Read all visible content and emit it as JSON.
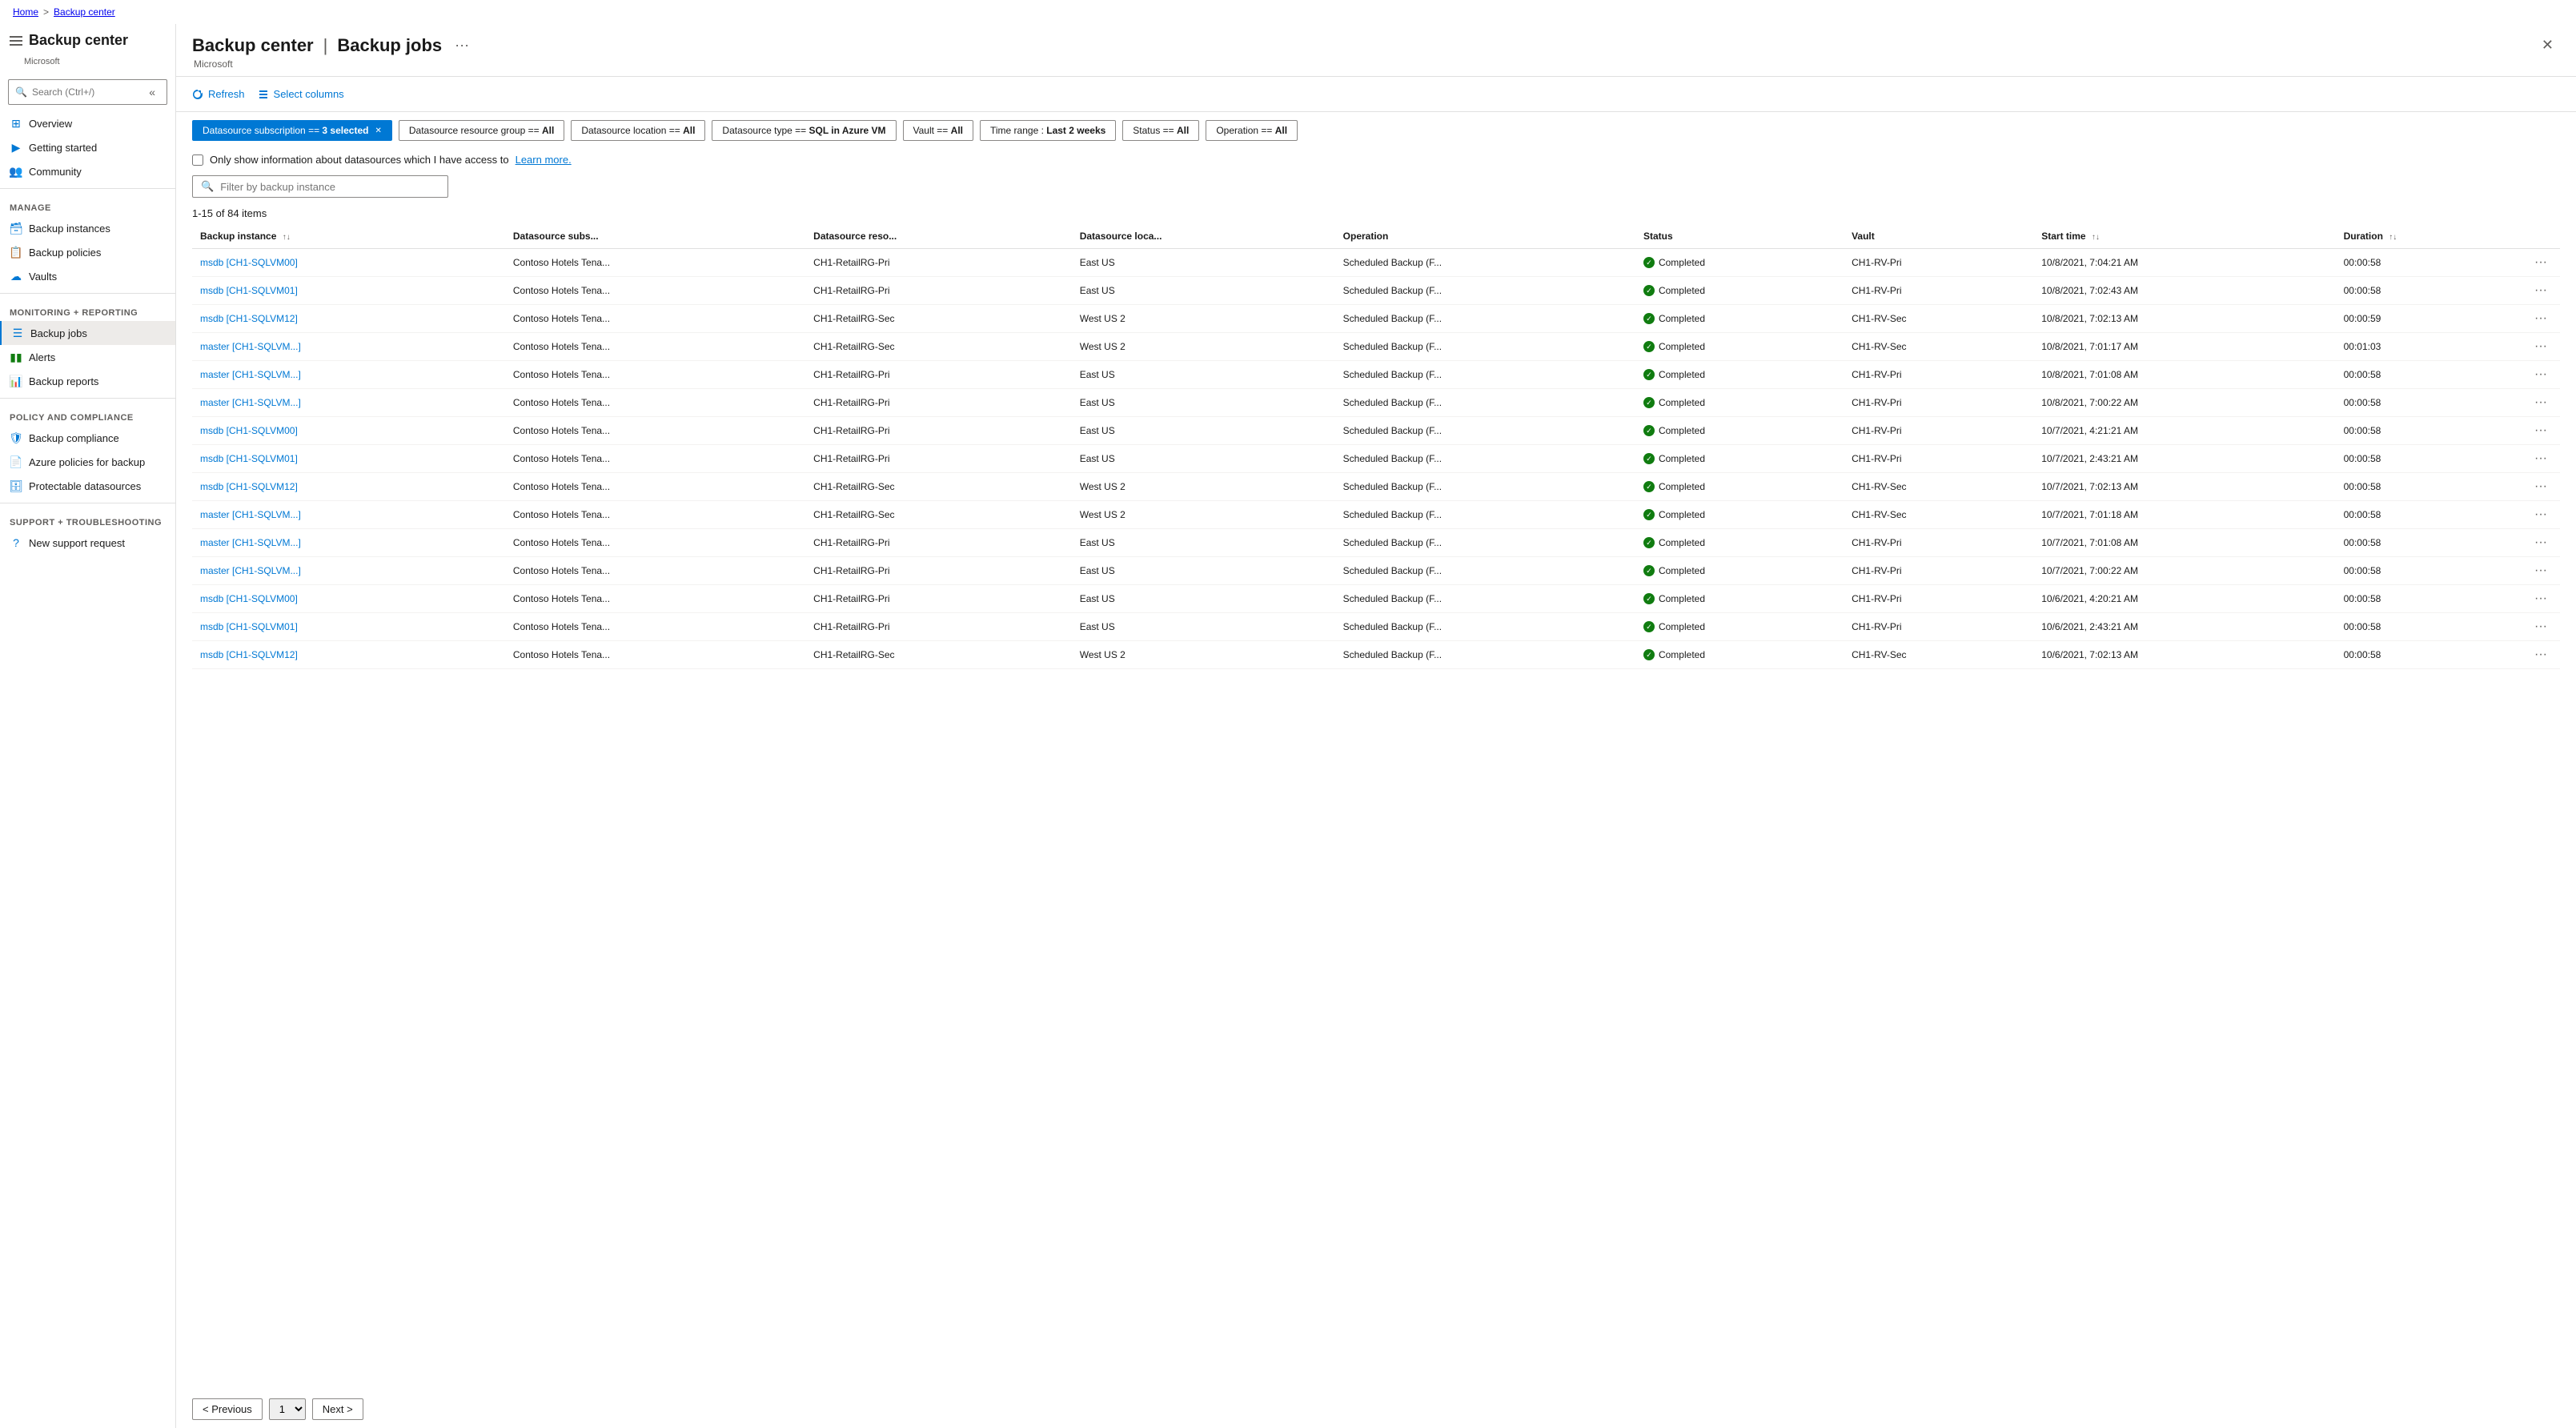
{
  "breadcrumb": {
    "home": "Home",
    "separator": ">",
    "current": "Backup center"
  },
  "page": {
    "service_title": "Backup center",
    "title": "Backup jobs",
    "separator": "|",
    "brand": "Microsoft",
    "ellipsis": "···"
  },
  "sidebar": {
    "search_placeholder": "Search (Ctrl+/)",
    "collapse_label": "«",
    "sections": [
      {
        "label": "",
        "items": [
          {
            "id": "overview",
            "label": "Overview",
            "icon": "⊞"
          },
          {
            "id": "getting-started",
            "label": "Getting started",
            "icon": "🚀"
          },
          {
            "id": "community",
            "label": "Community",
            "icon": "👥"
          }
        ]
      },
      {
        "label": "Manage",
        "items": [
          {
            "id": "backup-instances",
            "label": "Backup instances",
            "icon": "🗃"
          },
          {
            "id": "backup-policies",
            "label": "Backup policies",
            "icon": "📋"
          },
          {
            "id": "vaults",
            "label": "Vaults",
            "icon": "☁"
          }
        ]
      },
      {
        "label": "Monitoring + reporting",
        "items": [
          {
            "id": "backup-jobs",
            "label": "Backup jobs",
            "icon": "≡",
            "active": true
          },
          {
            "id": "alerts",
            "label": "Alerts",
            "icon": "🔔"
          },
          {
            "id": "backup-reports",
            "label": "Backup reports",
            "icon": "📊"
          }
        ]
      },
      {
        "label": "Policy and compliance",
        "items": [
          {
            "id": "backup-compliance",
            "label": "Backup compliance",
            "icon": "🛡"
          },
          {
            "id": "azure-policies",
            "label": "Azure policies for backup",
            "icon": "📄"
          },
          {
            "id": "protectable-datasources",
            "label": "Protectable datasources",
            "icon": "🗄"
          }
        ]
      },
      {
        "label": "Support + troubleshooting",
        "items": [
          {
            "id": "new-support",
            "label": "New support request",
            "icon": "?"
          }
        ]
      }
    ]
  },
  "toolbar": {
    "refresh_label": "Refresh",
    "select_columns_label": "Select columns"
  },
  "filters": [
    {
      "id": "datasource-subscription",
      "label": "Datasource subscription == 3 selected",
      "active": true
    },
    {
      "id": "datasource-resource-group",
      "label": "Datasource resource group == All",
      "active": false
    },
    {
      "id": "datasource-location",
      "label": "Datasource location == All",
      "active": false
    },
    {
      "id": "datasource-type",
      "label": "Datasource type == SQL in Azure VM",
      "active": false
    },
    {
      "id": "vault",
      "label": "Vault == All",
      "active": false
    },
    {
      "id": "time-range",
      "label": "Time range : Last 2 weeks",
      "active": false
    },
    {
      "id": "status",
      "label": "Status == All",
      "active": false
    },
    {
      "id": "operation",
      "label": "Operation == All",
      "active": false
    }
  ],
  "checkbox": {
    "label": "Only show information about datasources which I have access to",
    "link_text": "Learn more."
  },
  "search_filter": {
    "placeholder": "Filter by backup instance"
  },
  "items_count": "1-15 of 84 items",
  "table": {
    "columns": [
      {
        "id": "backup-instance",
        "label": "Backup instance",
        "sortable": true
      },
      {
        "id": "datasource-subs",
        "label": "Datasource subs...",
        "sortable": false
      },
      {
        "id": "datasource-reso",
        "label": "Datasource reso...",
        "sortable": false
      },
      {
        "id": "datasource-loca",
        "label": "Datasource loca...",
        "sortable": false
      },
      {
        "id": "operation",
        "label": "Operation",
        "sortable": false
      },
      {
        "id": "status",
        "label": "Status",
        "sortable": false
      },
      {
        "id": "vault",
        "label": "Vault",
        "sortable": false
      },
      {
        "id": "start-time",
        "label": "Start time",
        "sortable": true
      },
      {
        "id": "duration",
        "label": "Duration",
        "sortable": true
      }
    ],
    "rows": [
      {
        "backup_instance": "msdb [CH1-SQLVM00]",
        "datasource_subs": "Contoso Hotels Tena...",
        "datasource_reso": "CH1-RetailRG-Pri",
        "datasource_loca": "East US",
        "operation": "Scheduled Backup (F...",
        "status": "Completed",
        "vault": "CH1-RV-Pri",
        "start_time": "10/8/2021, 7:04:21 AM",
        "duration": "00:00:58"
      },
      {
        "backup_instance": "msdb [CH1-SQLVM01]",
        "datasource_subs": "Contoso Hotels Tena...",
        "datasource_reso": "CH1-RetailRG-Pri",
        "datasource_loca": "East US",
        "operation": "Scheduled Backup (F...",
        "status": "Completed",
        "vault": "CH1-RV-Pri",
        "start_time": "10/8/2021, 7:02:43 AM",
        "duration": "00:00:58"
      },
      {
        "backup_instance": "msdb [CH1-SQLVM12]",
        "datasource_subs": "Contoso Hotels Tena...",
        "datasource_reso": "CH1-RetailRG-Sec",
        "datasource_loca": "West US 2",
        "operation": "Scheduled Backup (F...",
        "status": "Completed",
        "vault": "CH1-RV-Sec",
        "start_time": "10/8/2021, 7:02:13 AM",
        "duration": "00:00:59"
      },
      {
        "backup_instance": "master [CH1-SQLVM...]",
        "datasource_subs": "Contoso Hotels Tena...",
        "datasource_reso": "CH1-RetailRG-Sec",
        "datasource_loca": "West US 2",
        "operation": "Scheduled Backup (F...",
        "status": "Completed",
        "vault": "CH1-RV-Sec",
        "start_time": "10/8/2021, 7:01:17 AM",
        "duration": "00:01:03"
      },
      {
        "backup_instance": "master [CH1-SQLVM...]",
        "datasource_subs": "Contoso Hotels Tena...",
        "datasource_reso": "CH1-RetailRG-Pri",
        "datasource_loca": "East US",
        "operation": "Scheduled Backup (F...",
        "status": "Completed",
        "vault": "CH1-RV-Pri",
        "start_time": "10/8/2021, 7:01:08 AM",
        "duration": "00:00:58"
      },
      {
        "backup_instance": "master [CH1-SQLVM...]",
        "datasource_subs": "Contoso Hotels Tena...",
        "datasource_reso": "CH1-RetailRG-Pri",
        "datasource_loca": "East US",
        "operation": "Scheduled Backup (F...",
        "status": "Completed",
        "vault": "CH1-RV-Pri",
        "start_time": "10/8/2021, 7:00:22 AM",
        "duration": "00:00:58"
      },
      {
        "backup_instance": "msdb [CH1-SQLVM00]",
        "datasource_subs": "Contoso Hotels Tena...",
        "datasource_reso": "CH1-RetailRG-Pri",
        "datasource_loca": "East US",
        "operation": "Scheduled Backup (F...",
        "status": "Completed",
        "vault": "CH1-RV-Pri",
        "start_time": "10/7/2021, 4:21:21 AM",
        "duration": "00:00:58"
      },
      {
        "backup_instance": "msdb [CH1-SQLVM01]",
        "datasource_subs": "Contoso Hotels Tena...",
        "datasource_reso": "CH1-RetailRG-Pri",
        "datasource_loca": "East US",
        "operation": "Scheduled Backup (F...",
        "status": "Completed",
        "vault": "CH1-RV-Pri",
        "start_time": "10/7/2021, 2:43:21 AM",
        "duration": "00:00:58"
      },
      {
        "backup_instance": "msdb [CH1-SQLVM12]",
        "datasource_subs": "Contoso Hotels Tena...",
        "datasource_reso": "CH1-RetailRG-Sec",
        "datasource_loca": "West US 2",
        "operation": "Scheduled Backup (F...",
        "status": "Completed",
        "vault": "CH1-RV-Sec",
        "start_time": "10/7/2021, 7:02:13 AM",
        "duration": "00:00:58"
      },
      {
        "backup_instance": "master [CH1-SQLVM...]",
        "datasource_subs": "Contoso Hotels Tena...",
        "datasource_reso": "CH1-RetailRG-Sec",
        "datasource_loca": "West US 2",
        "operation": "Scheduled Backup (F...",
        "status": "Completed",
        "vault": "CH1-RV-Sec",
        "start_time": "10/7/2021, 7:01:18 AM",
        "duration": "00:00:58"
      },
      {
        "backup_instance": "master [CH1-SQLVM...]",
        "datasource_subs": "Contoso Hotels Tena...",
        "datasource_reso": "CH1-RetailRG-Pri",
        "datasource_loca": "East US",
        "operation": "Scheduled Backup (F...",
        "status": "Completed",
        "vault": "CH1-RV-Pri",
        "start_time": "10/7/2021, 7:01:08 AM",
        "duration": "00:00:58"
      },
      {
        "backup_instance": "master [CH1-SQLVM...]",
        "datasource_subs": "Contoso Hotels Tena...",
        "datasource_reso": "CH1-RetailRG-Pri",
        "datasource_loca": "East US",
        "operation": "Scheduled Backup (F...",
        "status": "Completed",
        "vault": "CH1-RV-Pri",
        "start_time": "10/7/2021, 7:00:22 AM",
        "duration": "00:00:58"
      },
      {
        "backup_instance": "msdb [CH1-SQLVM00]",
        "datasource_subs": "Contoso Hotels Tena...",
        "datasource_reso": "CH1-RetailRG-Pri",
        "datasource_loca": "East US",
        "operation": "Scheduled Backup (F...",
        "status": "Completed",
        "vault": "CH1-RV-Pri",
        "start_time": "10/6/2021, 4:20:21 AM",
        "duration": "00:00:58"
      },
      {
        "backup_instance": "msdb [CH1-SQLVM01]",
        "datasource_subs": "Contoso Hotels Tena...",
        "datasource_reso": "CH1-RetailRG-Pri",
        "datasource_loca": "East US",
        "operation": "Scheduled Backup (F...",
        "status": "Completed",
        "vault": "CH1-RV-Pri",
        "start_time": "10/6/2021, 2:43:21 AM",
        "duration": "00:00:58"
      },
      {
        "backup_instance": "msdb [CH1-SQLVM12]",
        "datasource_subs": "Contoso Hotels Tena...",
        "datasource_reso": "CH1-RetailRG-Sec",
        "datasource_loca": "West US 2",
        "operation": "Scheduled Backup (F...",
        "status": "Completed",
        "vault": "CH1-RV-Sec",
        "start_time": "10/6/2021, 7:02:13 AM",
        "duration": "00:00:58"
      }
    ]
  },
  "pagination": {
    "prev_label": "< Previous",
    "next_label": "Next >",
    "page_number": "1"
  },
  "colors": {
    "accent": "#0078d4",
    "success": "#107c10",
    "active_filter_bg": "#0078d4",
    "active_filter_text": "#ffffff",
    "active_nav_border": "#0078d4"
  }
}
